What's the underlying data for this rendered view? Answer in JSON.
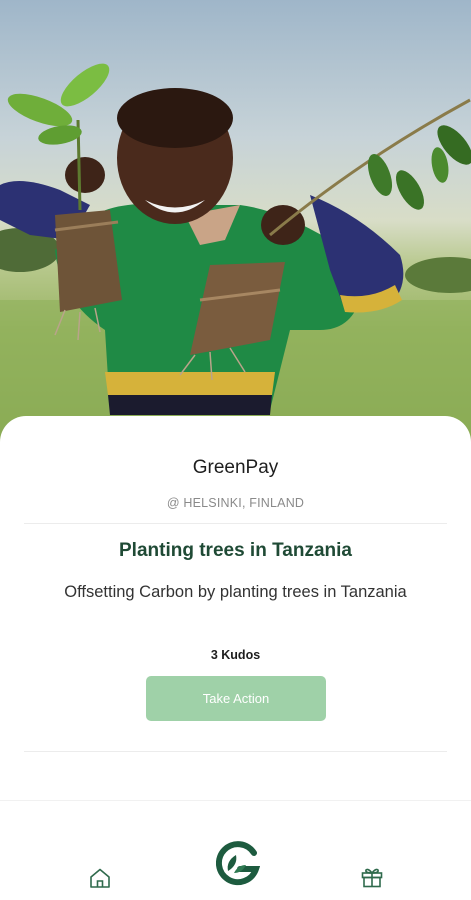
{
  "hero": {
    "image_description_icon": "photo-child-holding-tree-seedlings"
  },
  "card": {
    "org_name": "GreenPay",
    "location": "@ HELSINKI, FINLAND",
    "project_title": "Planting trees in Tanzania",
    "project_description": "Offsetting Carbon by planting trees in Tanzania",
    "kudos": "3 Kudos",
    "cta_label": "Take Action"
  },
  "bottom_nav": {
    "items": [
      {
        "icon": "home-icon"
      },
      {
        "icon": "greenpay-logo-icon"
      },
      {
        "icon": "gift-icon"
      }
    ]
  },
  "colors": {
    "title_green": "#1f4a35",
    "cta_green": "#9fd1a8",
    "logo_green": "#1d5b3f"
  }
}
